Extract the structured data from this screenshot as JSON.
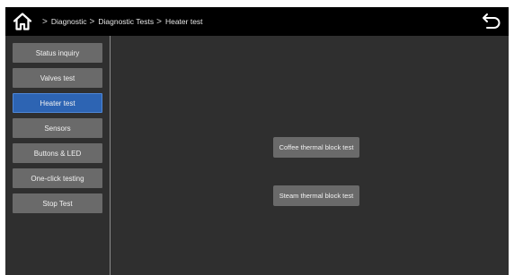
{
  "header": {
    "breadcrumb": [
      "Diagnostic",
      "Diagnostic Tests",
      "Heater test"
    ],
    "separator": ">",
    "home_icon": "home-icon",
    "back_icon": "back-arrow-icon"
  },
  "sidebar": {
    "active_index": 2,
    "items": [
      {
        "label": "Status inquiry"
      },
      {
        "label": "Valves test"
      },
      {
        "label": "Heater test"
      },
      {
        "label": "Sensors"
      },
      {
        "label": "Buttons & LED"
      },
      {
        "label": "One-click testing"
      },
      {
        "label": "Stop Test"
      }
    ]
  },
  "main": {
    "tests": [
      {
        "label": "Coffee thermal block test"
      },
      {
        "label": "Steam thermal block test"
      }
    ]
  },
  "colors": {
    "topbar": "#000000",
    "background": "#2f2f2f",
    "button": "#6a6a6a",
    "active_button": "#2d64b3",
    "text": "#f2f2f2"
  }
}
